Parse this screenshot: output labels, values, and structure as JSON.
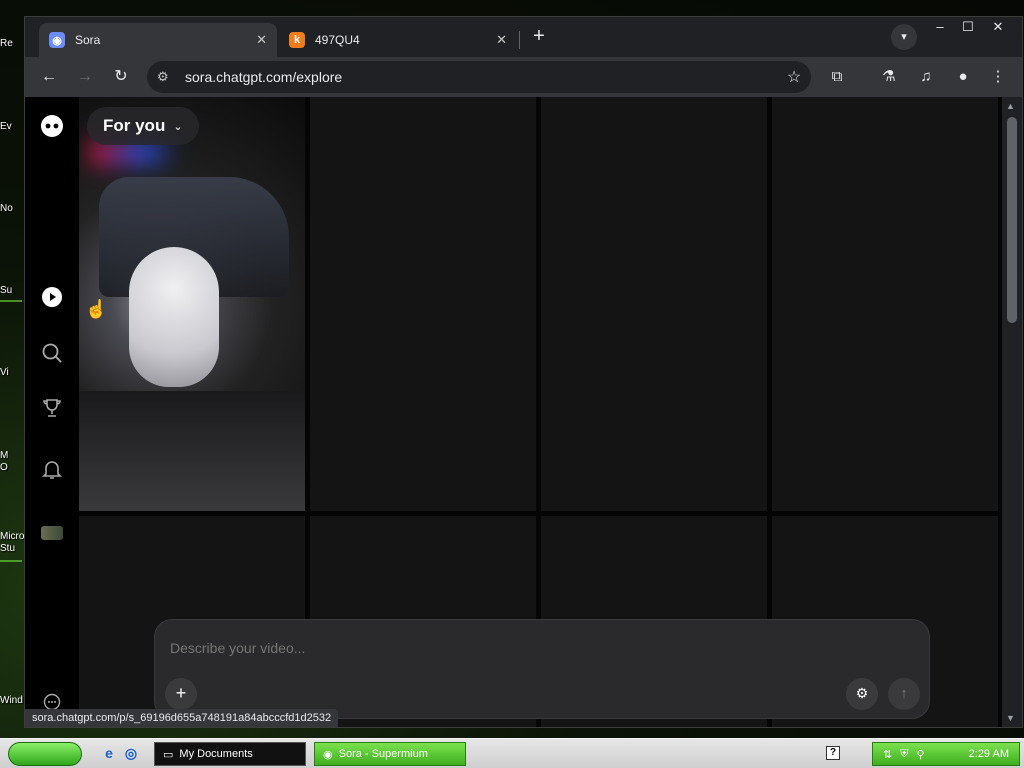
{
  "desktop": {
    "icon_labels": [
      "Re",
      "Ev",
      "No",
      "Su",
      "Vi",
      "M",
      "O",
      "Micro",
      "Stu",
      "Wind"
    ]
  },
  "browser": {
    "tabs": [
      {
        "title": "Sora",
        "icon": "sora-logo-icon",
        "active": true
      },
      {
        "title": "497QU4",
        "icon": "k-logo-icon",
        "active": false
      }
    ],
    "new_tab_label": "+",
    "window_controls": {
      "minimize": "–",
      "maximize": "☐",
      "close": "✕"
    },
    "url": "sora.chatgpt.com/explore",
    "status_url": "sora.chatgpt.com/p/s_69196d655a748191a84abcccfd1d2532"
  },
  "sora": {
    "feed_selector": "For you",
    "sidebar_items": [
      "home-icon",
      "search-icon",
      "trophy-icon",
      "bell-icon",
      "avatar",
      "more-icon"
    ],
    "composer": {
      "placeholder": "Describe your video...",
      "add_label": "+",
      "settings_label": "⚙",
      "send_label": "↑"
    }
  },
  "taskbar": {
    "tasks": [
      {
        "label": "My Documents"
      },
      {
        "label": "Sora - Supermium"
      }
    ],
    "clock": "2:29 AM"
  }
}
